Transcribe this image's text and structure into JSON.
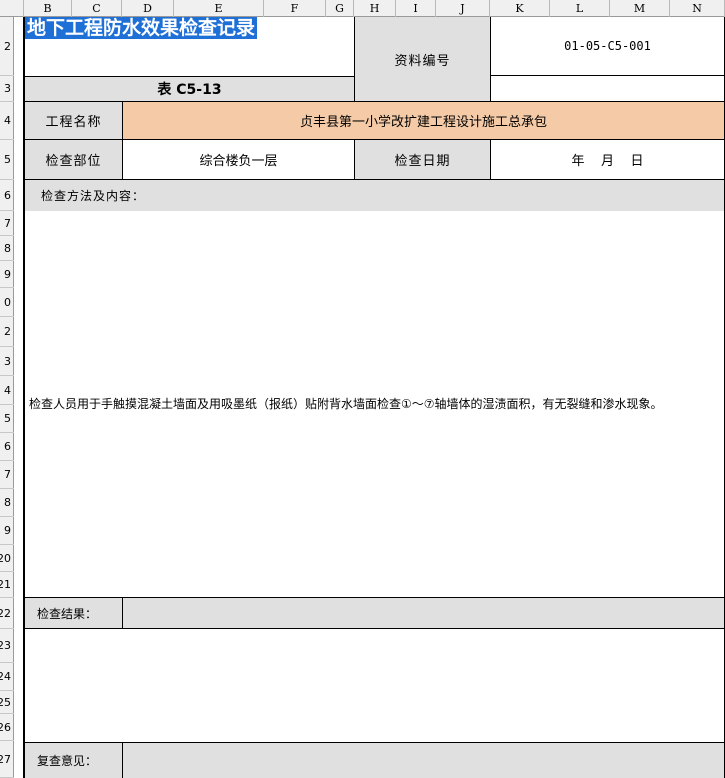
{
  "columns": [
    "B",
    "C",
    "D",
    "E",
    "F",
    "G",
    "H",
    "I",
    "J",
    "K",
    "L",
    "M",
    "N"
  ],
  "rows": [
    "2",
    "3",
    "4",
    "5",
    "6",
    "7",
    "8",
    "9",
    "0",
    "2",
    "3",
    "4",
    "5",
    "6",
    "7",
    "8",
    "9",
    "20",
    "21",
    "22",
    "23",
    "24",
    "25",
    "26",
    "27"
  ],
  "title": "地下工程防水效果检查记录",
  "doc_no_label": "资料编号",
  "doc_no_value": "01-05-C5-001",
  "table_no": "表  C5-13",
  "project_name_label": "工程名称",
  "project_name_value": "贞丰县第一小学改扩建工程设计施工总承包",
  "inspect_part_label": "检查部位",
  "inspect_part_value": "综合楼负一层",
  "inspect_date_label": "检查日期",
  "inspect_date_value": "年    月    日",
  "method_label": "检查方法及内容：",
  "method_text": "检查人员用于手触摸混凝土墙面及用吸墨纸（报纸）贴附背水墙面检查①～⑦轴墙体的湿渍面积，有无裂缝和渗水现象。",
  "result_label": "检查结果：",
  "review_label": "复查意见："
}
